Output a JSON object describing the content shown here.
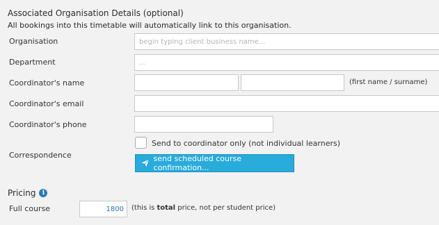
{
  "org_section": {
    "title": "Associated Organisation Details (optional)",
    "subtitle": "All bookings into this timetable will automatically link to this organisation."
  },
  "fields": {
    "organisation": {
      "label": "Organisation",
      "placeholder": "begin typing client business name..."
    },
    "department": {
      "label": "Department",
      "placeholder": "..."
    },
    "coordinator_name": {
      "label": "Coordinator's name",
      "first_value": "",
      "last_value": "",
      "hint": "(first name / surname)"
    },
    "coordinator_email": {
      "label": "Coordinator's email",
      "value": ""
    },
    "coordinator_phone": {
      "label": "Coordinator's phone",
      "value": ""
    },
    "correspondence": {
      "label": "Correspondence",
      "checkbox_label": "Send to coordinator only (not individual learners)",
      "checked": false,
      "button_label": "send scheduled course confirmation..."
    }
  },
  "pricing": {
    "title": "Pricing",
    "info_icon": "i",
    "full_course_label": "Full course",
    "full_course_value": "1800",
    "note_prefix": "(this is ",
    "note_bold": "total",
    "note_suffix": " price, not per student price)"
  },
  "colors": {
    "background": "#f2f2f2",
    "button": "#29abdc",
    "price_text": "#2a6fb5",
    "info_icon": "#2a7ab8"
  }
}
